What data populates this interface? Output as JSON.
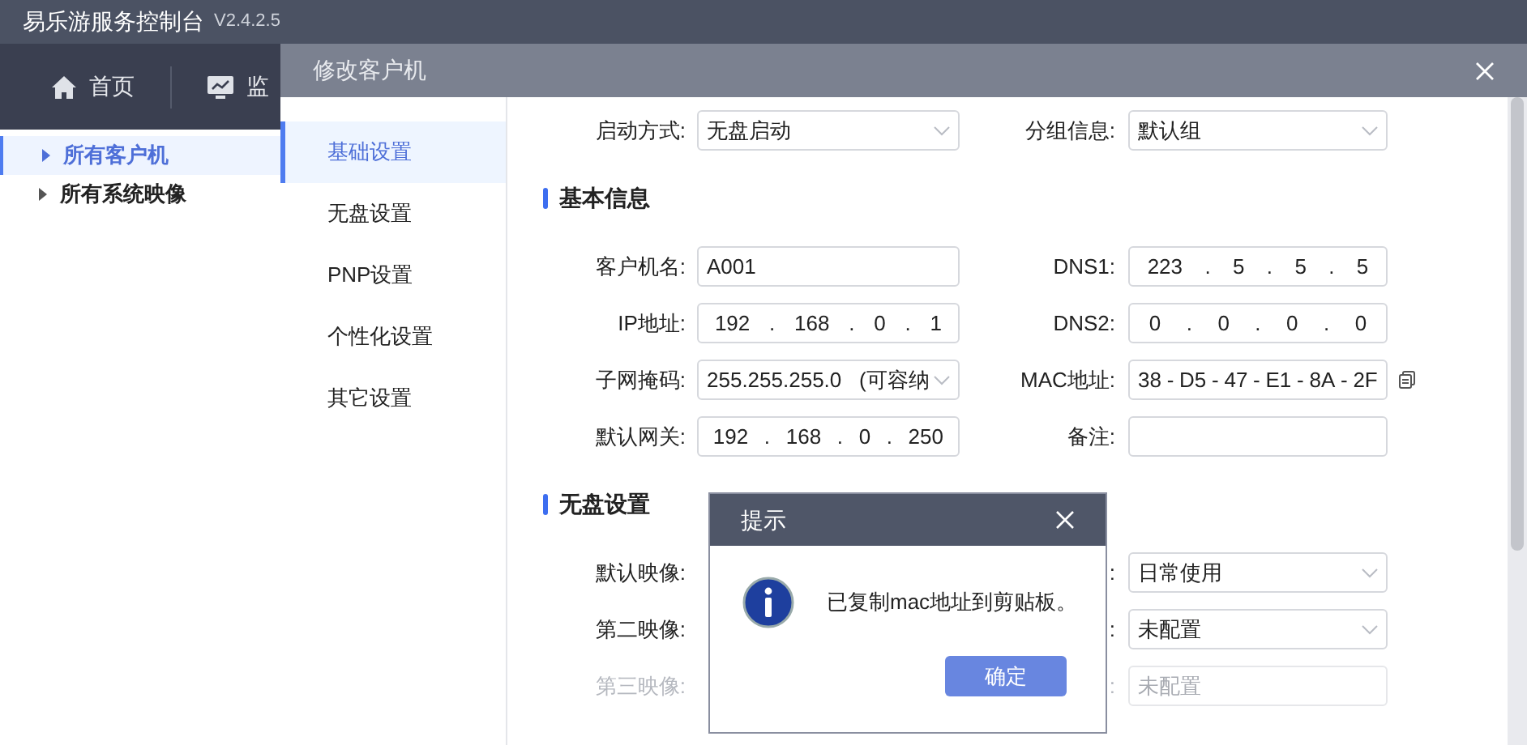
{
  "app": {
    "title": "易乐游服务控制台",
    "version": "V2.4.2.5"
  },
  "nav": [
    {
      "label": "首页"
    },
    {
      "label": "监"
    }
  ],
  "tree": [
    {
      "label": "所有客户机",
      "selected": true
    },
    {
      "label": "所有系统映像",
      "selected": false
    }
  ],
  "modal": {
    "title": "修改客户机",
    "menu": [
      {
        "label": "基础设置",
        "selected": true
      },
      {
        "label": "无盘设置",
        "selected": false
      },
      {
        "label": "PNP设置",
        "selected": false
      },
      {
        "label": "个性化设置",
        "selected": false
      },
      {
        "label": "其它设置",
        "selected": false
      }
    ],
    "top_row": {
      "left": {
        "label": "启动方式:",
        "kind": "select",
        "value": "无盘启动"
      },
      "right": {
        "label": "分组信息:",
        "kind": "select",
        "value": "默认组"
      }
    },
    "sections": [
      {
        "title": "基本信息",
        "rows": [
          {
            "left": {
              "label": "客户机名:",
              "kind": "text",
              "value": "A001"
            },
            "right": {
              "label": "DNS1:",
              "kind": "ip",
              "separator": ".",
              "segments": [
                "223",
                "5",
                "5",
                "5"
              ]
            }
          },
          {
            "left": {
              "label": "IP地址:",
              "kind": "ip",
              "separator": ".",
              "segments": [
                "192",
                "168",
                "0",
                "1"
              ]
            },
            "right": {
              "label": "DNS2:",
              "kind": "ip",
              "separator": ".",
              "segments": [
                "0",
                "0",
                "0",
                "0"
              ]
            }
          },
          {
            "left": {
              "label": "子网掩码:",
              "kind": "select",
              "value": "255.255.255.0   (可容纳"
            },
            "right": {
              "label": "MAC地址:",
              "kind": "mac",
              "separator": "-",
              "segments": [
                "38",
                "D5",
                "47",
                "E1",
                "8A",
                "2F"
              ]
            }
          },
          {
            "left": {
              "label": "默认网关:",
              "kind": "ip",
              "separator": ".",
              "segments": [
                "192",
                "168",
                "0",
                "250"
              ]
            },
            "right": {
              "label": "备注:",
              "kind": "text"
            }
          }
        ]
      },
      {
        "title": "无盘设置",
        "rows": [
          {
            "left": {
              "label": "默认映像:",
              "kind": "hidden",
              "disabled": false
            },
            "right": {
              "label": ":",
              "kind": "select",
              "value": "日常使用",
              "disabled": false
            }
          },
          {
            "left": {
              "label": "第二映像:",
              "kind": "hidden",
              "disabled": false
            },
            "right": {
              "label": ":",
              "kind": "select",
              "value": "未配置",
              "disabled": false
            }
          },
          {
            "left": {
              "label": "第三映像:",
              "kind": "hidden",
              "disabled": true
            },
            "right": {
              "label": ":",
              "kind": "disabled-text",
              "value": "未配置",
              "disabled": true
            }
          }
        ]
      }
    ]
  },
  "dialog": {
    "title": "提示",
    "message": "已复制mac地址到剪贴板。",
    "button": "确定"
  }
}
